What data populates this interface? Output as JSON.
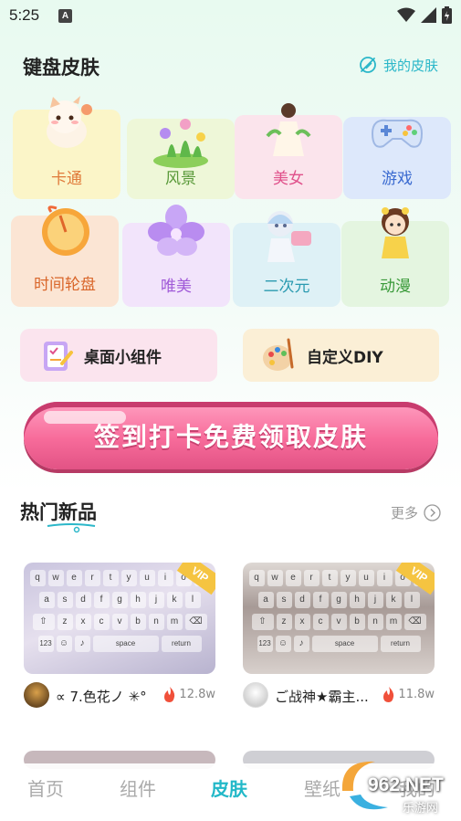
{
  "status": {
    "time": "5:25",
    "app_icon": "A"
  },
  "header": {
    "title": "键盘皮肤",
    "my_skin": "我的皮肤"
  },
  "categories": [
    {
      "label": "卡通",
      "icon": "cat-icon"
    },
    {
      "label": "风景",
      "icon": "flower-bush-icon"
    },
    {
      "label": "美女",
      "icon": "girl-icon"
    },
    {
      "label": "游戏",
      "icon": "gamepad-icon"
    },
    {
      "label": "时间轮盘",
      "icon": "wheel-icon"
    },
    {
      "label": "唯美",
      "icon": "flower-icon"
    },
    {
      "label": "二次元",
      "icon": "anime-icon"
    },
    {
      "label": "动漫",
      "icon": "doll-icon"
    }
  ],
  "tools": {
    "widgets": "桌面小组件",
    "diy": "自定义DIY"
  },
  "checkin": {
    "label": "签到打卡免费领取皮肤"
  },
  "section": {
    "title": "热门新品",
    "more": "更多"
  },
  "keyboard": {
    "row1": [
      "q",
      "w",
      "e",
      "r",
      "t",
      "y",
      "u",
      "i",
      "o",
      "p"
    ],
    "row2": [
      "a",
      "s",
      "d",
      "f",
      "g",
      "h",
      "j",
      "k",
      "l"
    ],
    "row3": [
      "z",
      "x",
      "c",
      "v",
      "b",
      "n",
      "m"
    ],
    "num": "123",
    "space": "space",
    "ret": "return"
  },
  "skins": [
    {
      "name": "∝ 7.色花ノ ✳°",
      "heat": "12.8w",
      "badge": "VIP"
    },
    {
      "name": "ご战神★霸主...",
      "heat": "11.8w",
      "badge": "VIP"
    }
  ],
  "nav": {
    "home": "首页",
    "widgets": "组件",
    "skin": "皮肤",
    "wallpaper": "壁纸",
    "mine": "我的"
  },
  "watermark": {
    "brand": "962.NET",
    "sub": "乐游网"
  },
  "colors": {
    "accent": "#22b8c8",
    "pink": "#f76b9a",
    "vip": "#f5c441"
  }
}
